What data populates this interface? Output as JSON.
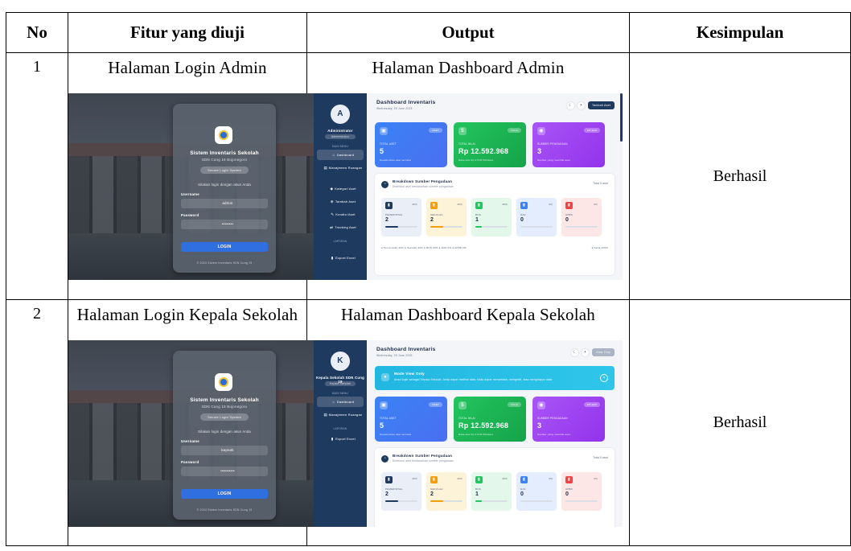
{
  "table": {
    "headers": {
      "no": "No",
      "fitur": "Fitur yang diuji",
      "output": "Output",
      "kesimpulan": "Kesimpulan"
    },
    "rows": [
      {
        "no": "1",
        "fitur": "Halaman Login Admin",
        "output": "Halaman Dashboard Admin",
        "kesimpulan": "Berhasil"
      },
      {
        "no": "2",
        "fitur": "Halaman Login Kepala Sekolah",
        "output": "Halaman Dashboard Kepala Sekolah",
        "kesimpulan": "Berhasil"
      }
    ]
  },
  "login_admin": {
    "title": "Sistem Inventaris Sekolah",
    "subtitle": "SDN Cung 19 Bojonegoro",
    "pill": "Secure Login System",
    "info": "Silakan login dengan akun Anda",
    "username_label": "Username",
    "username_value": "admin",
    "password_label": "Password",
    "password_value": "••••••••",
    "button": "LOGIN",
    "footer": "© 2024 Sistem Inventaris SDN Cung 19"
  },
  "login_kepsek": {
    "title": "Sistem Inventaris Sekolah",
    "subtitle": "SDN Cung 19 Bojonegoro",
    "pill": "Secure Login System",
    "info": "Silakan login dengan akun Anda",
    "username_label": "Username",
    "username_value": "kepsek",
    "password_label": "Password",
    "password_value": "••••••••••",
    "button": "LOGIN",
    "footer": "© 2024 Sistem Inventaris SDN Cung 19"
  },
  "dash_admin": {
    "avatar": "A",
    "user": "Administrator",
    "role": "Administrator",
    "sec_main": "MAIN MENU",
    "nav": [
      "Dashboard",
      "Manajemen Ruangan",
      "Kategori Aset",
      "Tambah Aset",
      "Kondisi Aset",
      "Tracking Aset"
    ],
    "sec_report": "LAPORAN",
    "export": "Export Excel",
    "title": "Dashboard Inventaris",
    "date": "Wednesday, 25 June 2025",
    "add": "Tambah Aset",
    "stats": [
      {
        "label": "TOTAL ASET",
        "value": "5",
        "badge": "ASET",
        "foot": "Keseluruhan aset tercatat"
      },
      {
        "label": "TOTAL NILAI",
        "value": "Rp 12.592.968",
        "badge": "NILAI",
        "foot": "Rata-rata Rp 2.518.594/aset"
      },
      {
        "label": "SUMBER PENGADAAN",
        "value": "3",
        "badge": "3/5 aktif",
        "foot": "Sumber yang memiliki aset"
      }
    ],
    "panel_title": "Breakdown Sumber Pengadaan",
    "panel_sub": "Distribusi aset berdasarkan sumber pengadaan",
    "panel_right": "Total 5 aset",
    "sources": [
      {
        "name": "PEMERINTAH",
        "value": "2",
        "pct": "40%",
        "fill": 0.4,
        "color": "#1f3a5f",
        "bg": "#e9eef7"
      },
      {
        "name": "SEKOLAH",
        "value": "2",
        "pct": "40%",
        "fill": 0.4,
        "color": "#f59e0b",
        "bg": "#fdf3d8"
      },
      {
        "name": "BOS",
        "value": "1",
        "pct": "20%",
        "fill": 0.2,
        "color": "#22c55e",
        "bg": "#e3f7ea"
      },
      {
        "name": "DAK",
        "value": "0",
        "pct": "0%",
        "fill": 0.0,
        "color": "#3b82f6",
        "bg": "#e4edfd"
      },
      {
        "name": "APBD",
        "value": "0",
        "pct": "0%",
        "fill": 0.0,
        "color": "#ef4444",
        "bg": "#fde6e6"
      }
    ],
    "legend": "● Pemerintah 40%  ● Sekolah 40%  ● BOS 20%  ● DAK 0%  ● APBD 0%",
    "legend_right": "● Dana 100%"
  },
  "dash_kepsek": {
    "avatar": "K",
    "user": "Kepala Sekolah SDN Cung 19",
    "role": "Kepala Sekolah",
    "sec_main": "MAIN MENU",
    "nav": [
      "Dashboard",
      "Manajemen Ruangan"
    ],
    "sec_report": "LAPORAN",
    "export": "Export Excel",
    "title": "Dashboard Inventaris",
    "date": "Wednesday, 25 June 2025",
    "add": "View Only",
    "banner_title": "Mode View Only",
    "banner_desc": "Anda login sebagai Kepala Sekolah. Anda dapat melihat data, tidak dapat menambah, mengedit, atau menghapus data.",
    "stats": [
      {
        "label": "TOTAL ASET",
        "value": "5",
        "badge": "ASET",
        "foot": "Keseluruhan aset tercatat"
      },
      {
        "label": "TOTAL NILAI",
        "value": "Rp 12.592.968",
        "badge": "NILAI",
        "foot": "Rata-rata Rp 2.518.594/aset"
      },
      {
        "label": "SUMBER PENGADAAN",
        "value": "3",
        "badge": "3/5 aktif",
        "foot": "Sumber yang memiliki aset"
      }
    ],
    "panel_title": "Breakdown Sumber Pengadaan",
    "panel_sub": "Distribusi aset berdasarkan sumber pengadaan",
    "panel_right": "Total 5 aset",
    "sources": [
      {
        "name": "PEMERINTAH",
        "value": "2",
        "pct": "40%",
        "fill": 0.4,
        "color": "#1f3a5f",
        "bg": "#e9eef7"
      },
      {
        "name": "SEKOLAH",
        "value": "2",
        "pct": "40%",
        "fill": 0.4,
        "color": "#f59e0b",
        "bg": "#fdf3d8"
      },
      {
        "name": "BOS",
        "value": "1",
        "pct": "20%",
        "fill": 0.2,
        "color": "#22c55e",
        "bg": "#e3f7ea"
      },
      {
        "name": "DAK",
        "value": "0",
        "pct": "0%",
        "fill": 0.0,
        "color": "#3b82f6",
        "bg": "#e4edfd"
      },
      {
        "name": "APBD",
        "value": "0",
        "pct": "0%",
        "fill": 0.0,
        "color": "#ef4444",
        "bg": "#fde6e6"
      }
    ]
  }
}
